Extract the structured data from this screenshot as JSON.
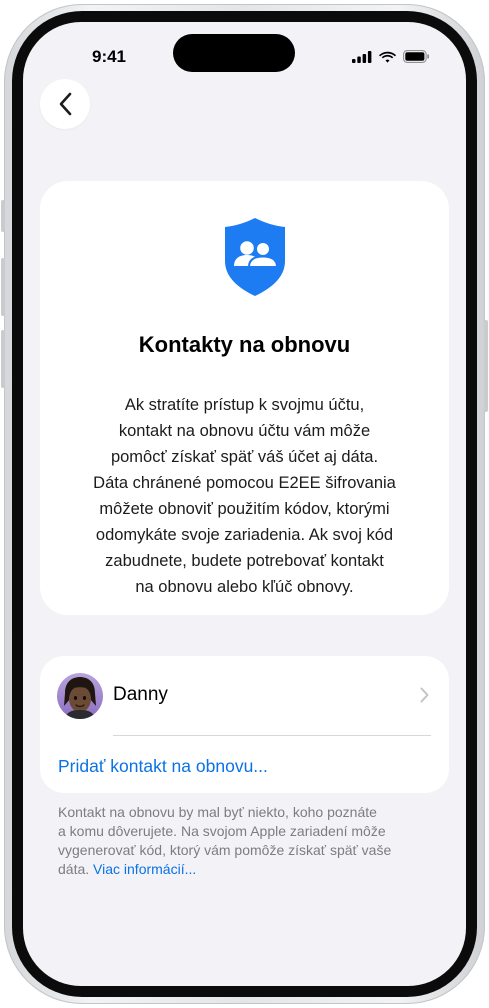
{
  "status_bar": {
    "time": "9:41"
  },
  "nav": {
    "back_icon": "chevron-left-icon"
  },
  "info_card": {
    "icon": "shield-people-icon",
    "title": "Kontakty na obnovu",
    "body": "Ak stratíte prístup k svojmu účtu,\nkontakt na obnovu účtu vám môže\npomôcť získať späť váš účet aj dáta.\nDáta chránené pomocou E2EE šifrovania\nmôžete obnoviť použitím kódov, ktorými\nodomykáte svoje zariadenia. Ak svoj kód\nzabudnete, budete potrebovať kontakt\nna obnovu alebo kľúč obnovy."
  },
  "contacts": {
    "items": [
      {
        "name": "Danny",
        "avatar": "memoji-avatar"
      }
    ],
    "add_label": "Pridať kontakt na obnovu..."
  },
  "footer": {
    "text": "Kontakt na obnovu by mal byť niekto, koho poznáte\na komu dôverujete. Na svojom Apple zariadení môže\nvygenerovať kód, ktorý vám pomôže získať späť vaše\ndáta. ",
    "link": "Viac informácií..."
  },
  "colors": {
    "accent": "#0a72e6",
    "shield": "#1e7cf2",
    "background": "#f2f2f7"
  }
}
